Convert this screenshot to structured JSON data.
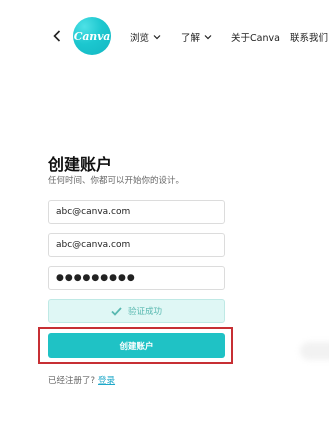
{
  "nav": {
    "logo_text": "Canva",
    "browse_label": "浏览",
    "learn_label": "了解",
    "about_label": "关于Canva",
    "contact_label": "联系我们"
  },
  "form": {
    "title": "创建账户",
    "subtitle": "任何时间、你都可以开始你的设计。",
    "email_value": "abc@canva.com",
    "confirm_email_value": "abc@canva.com",
    "password_masked": "●●●●●●●●●",
    "verify_text": "验证成功",
    "create_button_label": "创建账户",
    "already_registered_text": "已经注册了?",
    "login_link_label": "登录"
  },
  "colors": {
    "accent": "#1fc2c5",
    "highlight_border": "#c72f34",
    "verify_bg": "#dff7f5",
    "link": "#1fa8c9"
  }
}
